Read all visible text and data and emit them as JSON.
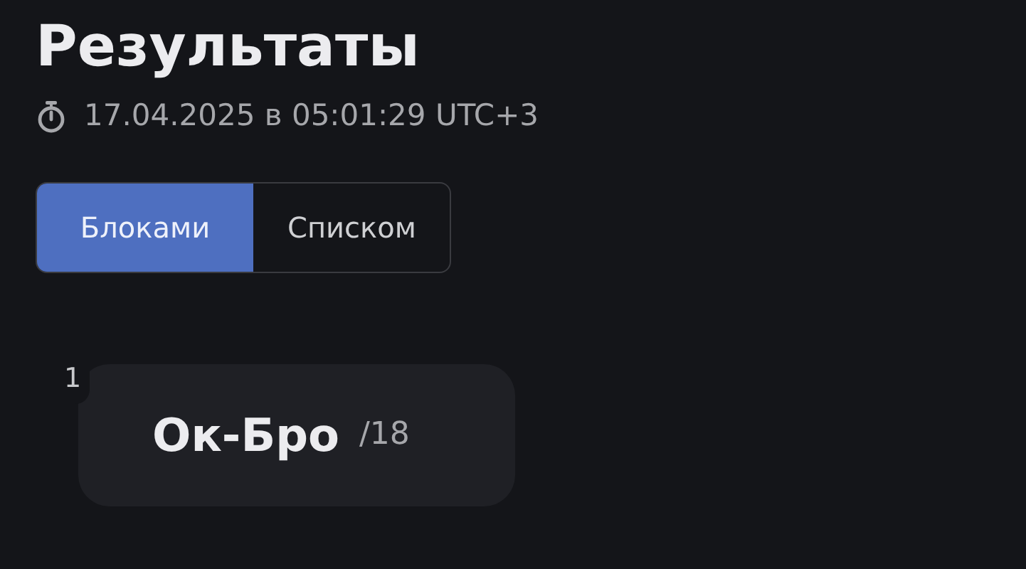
{
  "title": "Результаты",
  "timestamp": "17.04.2025 в 05:01:29 UTC+3",
  "view_toggle": [
    {
      "label": "Блоками",
      "selected": true
    },
    {
      "label": "Списком",
      "selected": false
    }
  ],
  "results": [
    {
      "rank": "1",
      "name": "Ок-Бро",
      "score": "/18"
    }
  ]
}
